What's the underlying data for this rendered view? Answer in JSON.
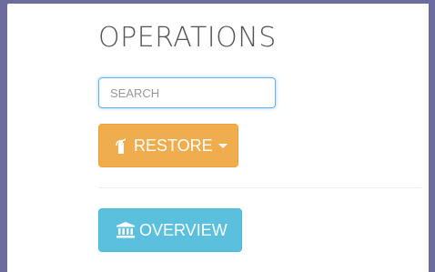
{
  "page": {
    "title": "OPERATIONS"
  },
  "search": {
    "placeholder": "SEARCH",
    "value": ""
  },
  "actions": {
    "restore": {
      "label": "RESTORE",
      "icon": "fire-extinguisher-icon",
      "color": "#f0ad4e"
    },
    "overview": {
      "label": "OVERVIEW",
      "icon": "bank-icon",
      "color": "#5bc0de"
    }
  }
}
